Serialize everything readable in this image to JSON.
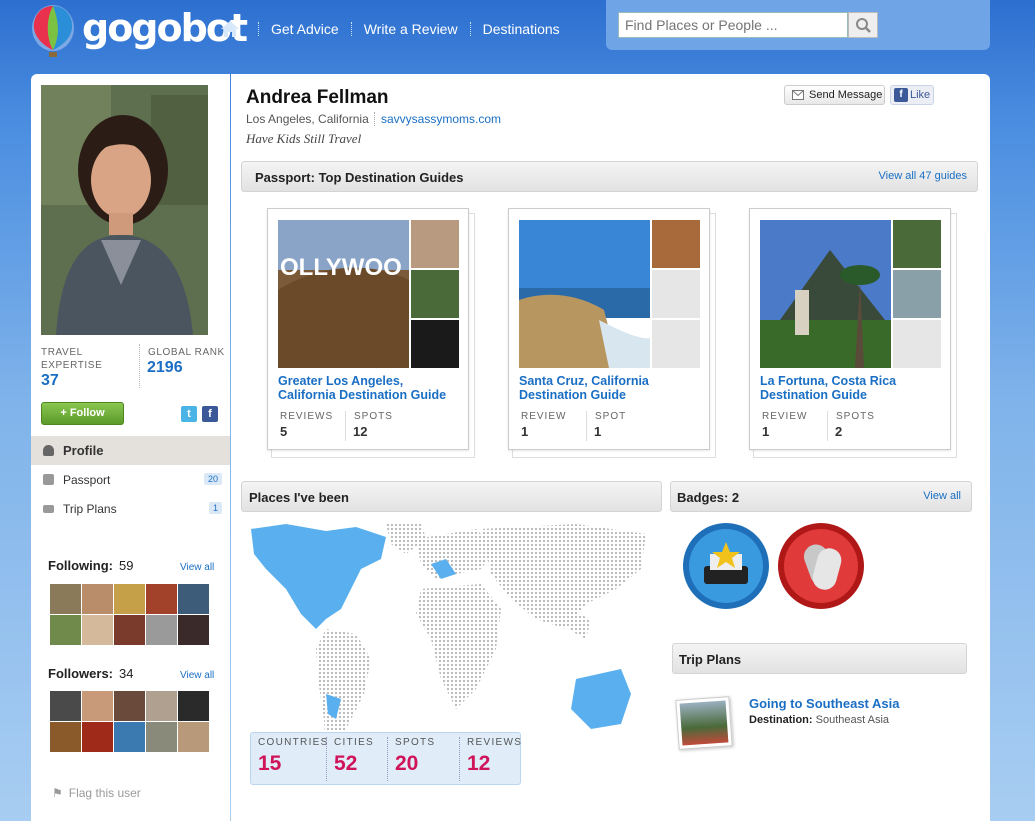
{
  "header": {
    "logo_text": "gogobot",
    "nav": [
      {
        "label": "Get Advice"
      },
      {
        "label": "Write a Review"
      },
      {
        "label": "Destinations"
      }
    ],
    "search_placeholder": "Find Places or People ..."
  },
  "profile": {
    "name": "Andrea Fellman",
    "location": "Los Angeles, California",
    "website": "savvysassymoms.com",
    "tagline": "Have Kids Still Travel",
    "send_message": "Send Message",
    "like": "Like",
    "travel_expertise_label": "TRAVEL EXPERTISE",
    "travel_expertise": "37",
    "global_rank_label": "GLOBAL RANK",
    "global_rank": "2196",
    "follow": "+ Follow"
  },
  "sidebar": {
    "menu": [
      {
        "label": "Profile",
        "count": ""
      },
      {
        "label": "Passport",
        "count": "20"
      },
      {
        "label": "Trip Plans",
        "count": "1"
      }
    ],
    "following_label": "Following:",
    "following_count": "59",
    "followers_label": "Followers:",
    "followers_count": "34",
    "view_all": "View all",
    "flag": "Flag this user"
  },
  "passport": {
    "title": "Passport: Top Destination Guides",
    "view_all": "View all 47 guides",
    "guides": [
      {
        "title": "Greater Los Angeles, California Destination Guide",
        "reviews_label": "REVIEWS",
        "reviews": "5",
        "spots_label": "SPOTS",
        "spots": "12"
      },
      {
        "title": "Santa Cruz, California Destination Guide",
        "reviews_label": "REVIEW",
        "reviews": "1",
        "spots_label": "SPOT",
        "spots": "1"
      },
      {
        "title": "La Fortuna, Costa Rica Destination Guide",
        "reviews_label": "REVIEW",
        "reviews": "1",
        "spots_label": "SPOTS",
        "spots": "2"
      }
    ],
    "hollywood_sign": "OLLYWOO"
  },
  "places": {
    "title": "Places I've been",
    "stats": [
      {
        "label": "COUNTRIES",
        "value": "15"
      },
      {
        "label": "CITIES",
        "value": "52"
      },
      {
        "label": "SPOTS",
        "value": "20"
      },
      {
        "label": "REVIEWS",
        "value": "12"
      }
    ]
  },
  "badges": {
    "title": "Badges: 2",
    "view_all": "View all"
  },
  "trip_plans": {
    "title": "Trip Plans",
    "plan_title": "Going to Southeast Asia",
    "dest_label": "Destination:",
    "dest_value": "Southeast Asia"
  },
  "colors": {
    "link": "#1a6fc4",
    "stat_number": "#d0145a",
    "follow_green": "#5c9a2a"
  }
}
